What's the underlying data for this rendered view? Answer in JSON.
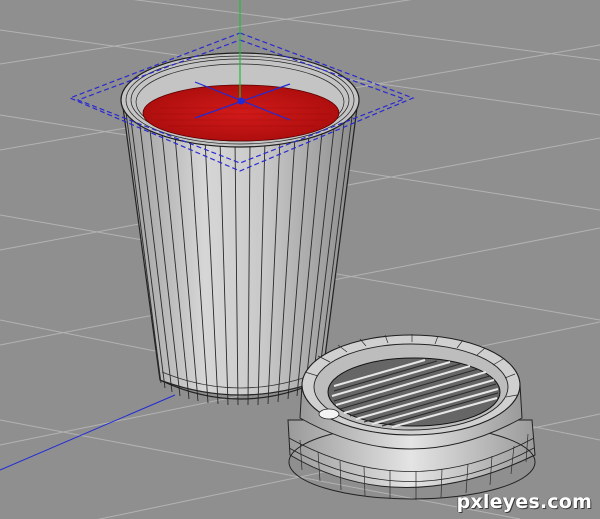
{
  "viewport": {
    "watermark": "pxleyes.com"
  },
  "colors": {
    "background": "#8f8f8f",
    "grid": "#b2b2b2",
    "axis_x": "#1f2bd6",
    "axis_y": "#1fbf3a",
    "selection_box": "#2a2ad0",
    "liquid": "#c01010",
    "mesh_fill": "#bdbdbd",
    "mesh_line": "#222222"
  },
  "objects": [
    {
      "name": "cup",
      "selected": true,
      "icon": "cylinder-mesh-icon"
    },
    {
      "name": "lid",
      "selected": false,
      "icon": "lid-mesh-icon"
    }
  ]
}
